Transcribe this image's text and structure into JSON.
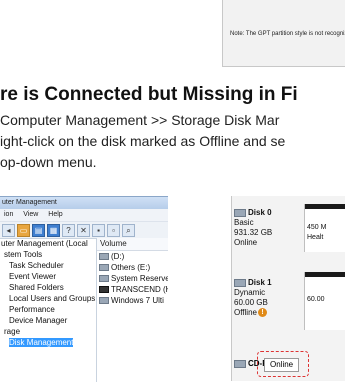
{
  "top": {
    "note": "Note: The GPT partition style is not recognized by Windows."
  },
  "heading": "re is Connected but Missing in Fi",
  "paragraph": {
    "line1": "Computer Management >> Storage Disk Mar",
    "line2": "ight-click on the disk marked as Offline and se",
    "line3": "op-down menu."
  },
  "computer_management": {
    "title": "uter Management",
    "menu": [
      "ion",
      "View",
      "Help"
    ],
    "tree": [
      "uter Management (Local",
      "stem Tools",
      "Task Scheduler",
      "Event Viewer",
      "Shared Folders",
      "Local Users and Groups",
      "Performance",
      "Device Manager",
      "rage",
      "Disk Management"
    ],
    "volume_header": "Volume",
    "volumes": [
      "(D:)",
      "Others (E:)",
      "System Reserve",
      "TRANSCEND (H",
      "Windows 7 Ulti"
    ]
  },
  "disk_management": {
    "disk0": {
      "name": "Disk 0",
      "type": "Basic",
      "size": "931.32 GB",
      "status": "Online",
      "part1": "450 M",
      "part2": "Healt"
    },
    "disk1": {
      "name": "Disk 1",
      "type": "Dynamic",
      "size": "60.00 GB",
      "status": "Offline",
      "part": "60.00"
    },
    "cd": "CD-R",
    "context_online": "Online"
  }
}
